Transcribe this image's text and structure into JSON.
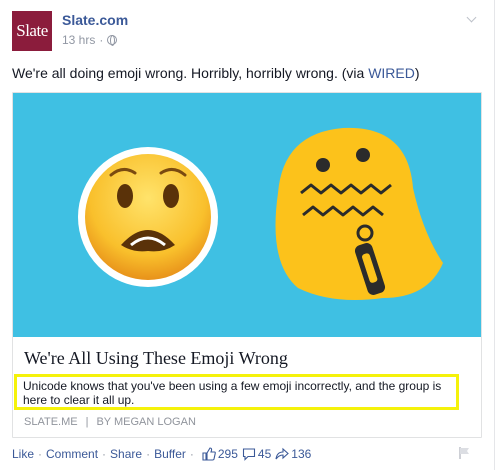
{
  "header": {
    "avatar_text": "Slate",
    "page_name": "Slate.com",
    "timestamp": "13 hrs",
    "audience_icon": "globe-icon"
  },
  "post": {
    "text_before_link": "We're all doing emoji wrong. Horribly, horribly wrong. (via ",
    "link_text": "WIRED",
    "text_after_link": ")"
  },
  "attachment": {
    "title": "We're All Using These Emoji Wrong",
    "description": "Unicode knows that you've been using a few emoji incorrectly, and the group is here to clear it all up.",
    "source": "SLATE.ME",
    "author": "BY MEGAN LOGAN",
    "image_background": "#3fc0e3",
    "highlight_color": "#f5f20a"
  },
  "actions": {
    "like": "Like",
    "comment": "Comment",
    "share": "Share",
    "buffer": "Buffer",
    "like_count": "295",
    "comment_count": "45",
    "share_count": "136"
  }
}
